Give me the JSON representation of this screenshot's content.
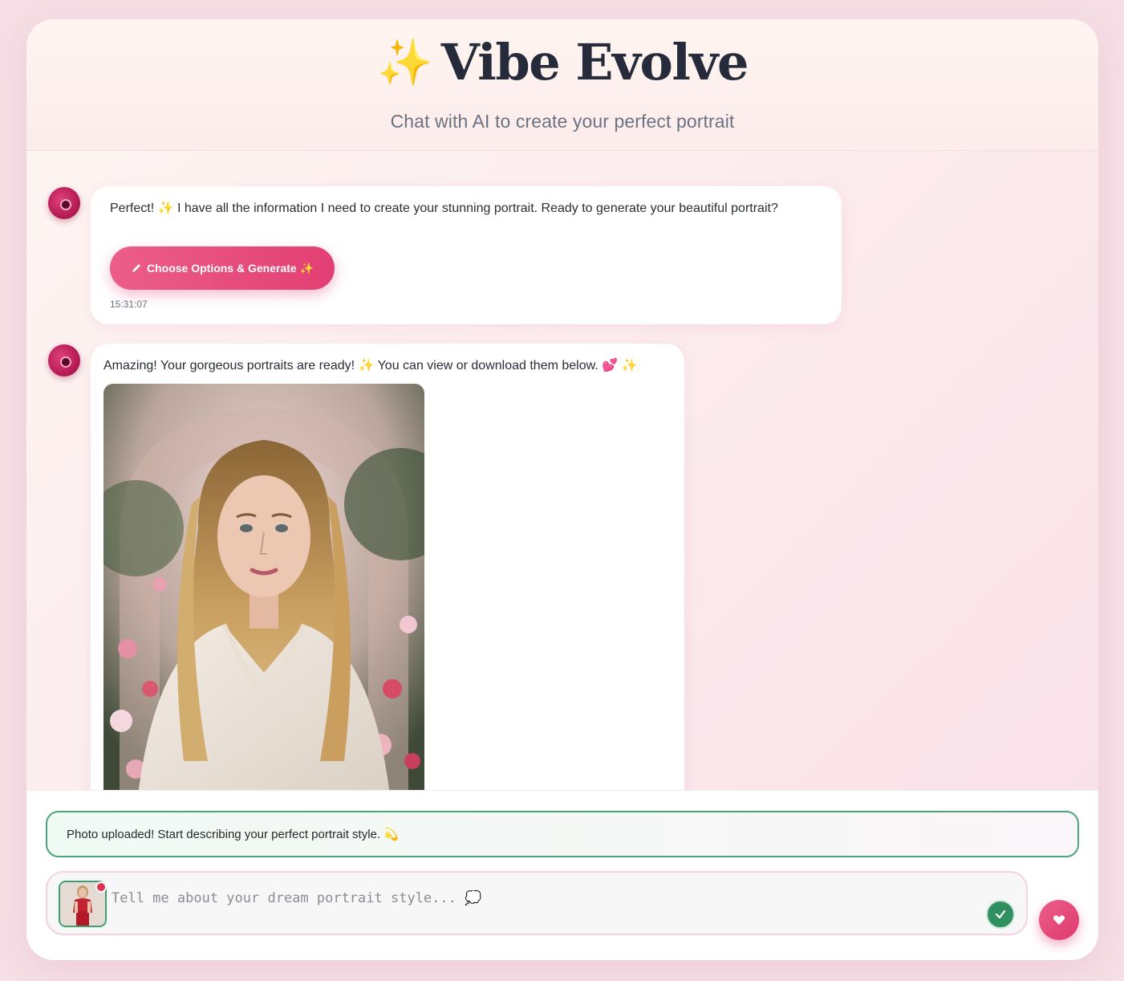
{
  "header": {
    "sparkle": "✨",
    "title": "Vibe Evolve",
    "subtitle": "Chat with AI to create your perfect portrait"
  },
  "messages": [
    {
      "text": "Perfect! ✨ I have all the information I need to create your stunning portrait. Ready to generate your beautiful portrait?",
      "button_label": "Choose Options & Generate ✨",
      "timestamp": "15:31:07"
    },
    {
      "text": "Amazing! Your gorgeous portraits are ready! ✨ You can view or download them below. 💕 ✨",
      "image_icon": "portrait-image"
    }
  ],
  "notice": {
    "text": "Photo uploaded! Start describing your perfect portrait style. 💫"
  },
  "composer": {
    "placeholder": "Tell me about your dream portrait style... 💭",
    "value": ""
  },
  "icons": {
    "edit": "pencil-icon",
    "check": "check-icon",
    "send": "heart-icon"
  },
  "colors": {
    "accent": "#e23f73",
    "success": "#2f8f5e",
    "title": "#262b3b"
  }
}
